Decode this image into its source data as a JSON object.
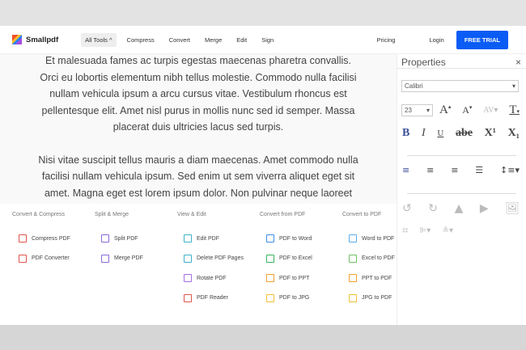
{
  "nav": {
    "brand": "Smallpdf",
    "all_tools": "All Tools ^",
    "links": [
      "Compress",
      "Convert",
      "Merge",
      "Edit",
      "Sign"
    ],
    "pricing": "Pricing",
    "login": "Login",
    "trial": "FREE TRIAL",
    "accent": "#0a5cf5"
  },
  "document": {
    "paragraphs": [
      "Et malesuada fames ac turpis egestas maecenas pharetra convallis. Orci eu lobortis elementum nibh tellus molestie. Commodo nulla facilisi nullam vehicula ipsum a arcu cursus vitae. Vestibulum rhoncus est pellentesque elit. Amet nisl purus in mollis nunc sed id semper. Massa placerat duis ultricies lacus sed turpis.",
      "Nisi vitae suscipit tellus mauris a diam maecenas. Amet commodo nulla facilisi nullam vehicula ipsum. Sed enim ut sem viverra aliquet eget sit amet. Magna eget est lorem ipsum dolor. Non pulvinar neque laoreet"
    ]
  },
  "panel": {
    "title": "Properties",
    "close": "×",
    "font": "Calibri",
    "size": "23",
    "bold": "B",
    "italic": "I",
    "underline": "U",
    "strike": "abe",
    "sup": "X¹",
    "sub": "X₁"
  },
  "menu": [
    {
      "title": "Convert & Compress",
      "items": [
        {
          "label": "Compress PDF",
          "color": "#e0544b"
        },
        {
          "label": "PDF Converter",
          "color": "#e0544b"
        }
      ]
    },
    {
      "title": "Split & Merge",
      "items": [
        {
          "label": "Split PDF",
          "color": "#8a6ad8"
        },
        {
          "label": "Merge PDF",
          "color": "#8a6ad8"
        }
      ]
    },
    {
      "title": "View & Edit",
      "items": [
        {
          "label": "Edit PDF",
          "color": "#3bb3c8"
        },
        {
          "label": "Delete PDF Pages",
          "color": "#3bb3c8"
        },
        {
          "label": "Rotate PDF",
          "color": "#a86ee0"
        },
        {
          "label": "PDF Reader",
          "color": "#e0544b"
        }
      ]
    },
    {
      "title": "Convert from PDF",
      "items": [
        {
          "label": "PDF to Word",
          "color": "#3b8ee8"
        },
        {
          "label": "PDF to Excel",
          "color": "#35b35a"
        },
        {
          "label": "PDF to PPT",
          "color": "#f0a030"
        },
        {
          "label": "PDF to JPG",
          "color": "#f0c030"
        }
      ]
    },
    {
      "title": "Convert to PDF",
      "items": [
        {
          "label": "Word to PDF",
          "color": "#5aaee8"
        },
        {
          "label": "Excel to PDF",
          "color": "#6cc060"
        },
        {
          "label": "PPT to PDF",
          "color": "#f0a030"
        },
        {
          "label": "JPG to PDF",
          "color": "#f0c030"
        }
      ]
    }
  ]
}
